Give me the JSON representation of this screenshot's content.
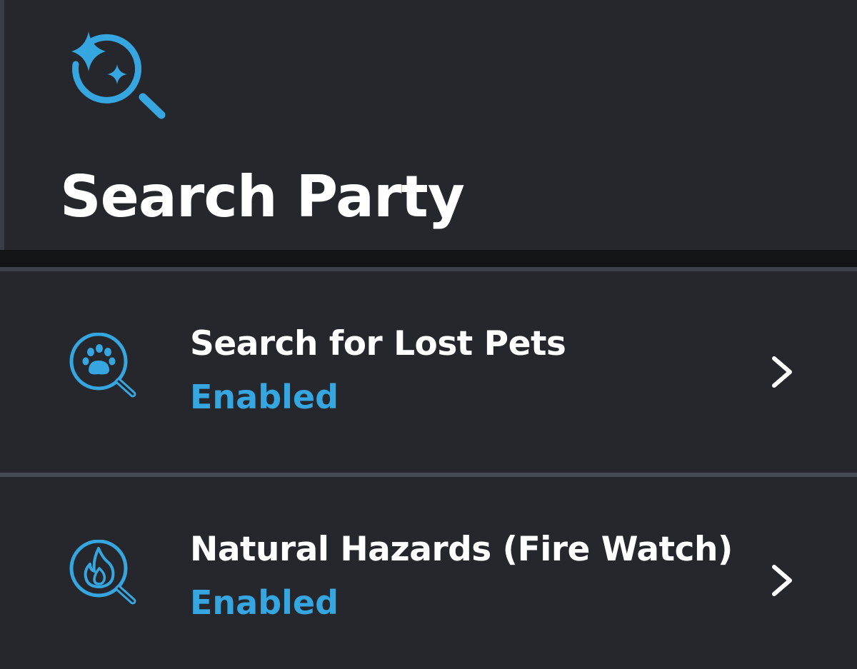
{
  "header": {
    "title": "Search Party",
    "icon": "sparkle-magnifier-icon"
  },
  "colors": {
    "background": "#25272c",
    "accent": "#35a6e0",
    "text": "#ffffff",
    "divider": "#464b52"
  },
  "items": [
    {
      "label": "Search for Lost Pets",
      "status": "Enabled",
      "icon": "paw-magnifier-icon"
    },
    {
      "label": "Natural Hazards (Fire Watch)",
      "status": "Enabled",
      "icon": "flame-magnifier-icon"
    }
  ]
}
